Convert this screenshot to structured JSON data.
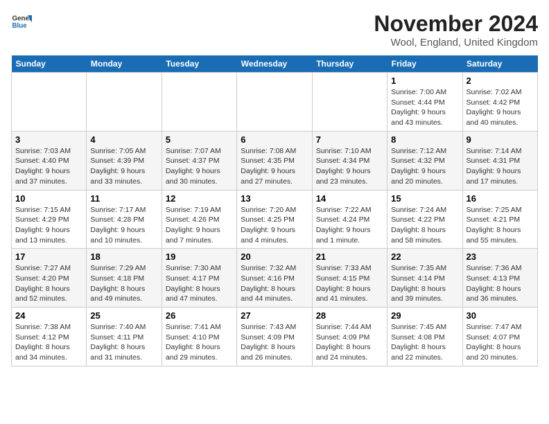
{
  "logo": {
    "line1": "General",
    "line2": "Blue"
  },
  "title": "November 2024",
  "subtitle": "Wool, England, United Kingdom",
  "days_of_week": [
    "Sunday",
    "Monday",
    "Tuesday",
    "Wednesday",
    "Thursday",
    "Friday",
    "Saturday"
  ],
  "weeks": [
    [
      {
        "day": "",
        "info": ""
      },
      {
        "day": "",
        "info": ""
      },
      {
        "day": "",
        "info": ""
      },
      {
        "day": "",
        "info": ""
      },
      {
        "day": "",
        "info": ""
      },
      {
        "day": "1",
        "info": "Sunrise: 7:00 AM\nSunset: 4:44 PM\nDaylight: 9 hours\nand 43 minutes."
      },
      {
        "day": "2",
        "info": "Sunrise: 7:02 AM\nSunset: 4:42 PM\nDaylight: 9 hours\nand 40 minutes."
      }
    ],
    [
      {
        "day": "3",
        "info": "Sunrise: 7:03 AM\nSunset: 4:40 PM\nDaylight: 9 hours\nand 37 minutes."
      },
      {
        "day": "4",
        "info": "Sunrise: 7:05 AM\nSunset: 4:39 PM\nDaylight: 9 hours\nand 33 minutes."
      },
      {
        "day": "5",
        "info": "Sunrise: 7:07 AM\nSunset: 4:37 PM\nDaylight: 9 hours\nand 30 minutes."
      },
      {
        "day": "6",
        "info": "Sunrise: 7:08 AM\nSunset: 4:35 PM\nDaylight: 9 hours\nand 27 minutes."
      },
      {
        "day": "7",
        "info": "Sunrise: 7:10 AM\nSunset: 4:34 PM\nDaylight: 9 hours\nand 23 minutes."
      },
      {
        "day": "8",
        "info": "Sunrise: 7:12 AM\nSunset: 4:32 PM\nDaylight: 9 hours\nand 20 minutes."
      },
      {
        "day": "9",
        "info": "Sunrise: 7:14 AM\nSunset: 4:31 PM\nDaylight: 9 hours\nand 17 minutes."
      }
    ],
    [
      {
        "day": "10",
        "info": "Sunrise: 7:15 AM\nSunset: 4:29 PM\nDaylight: 9 hours\nand 13 minutes."
      },
      {
        "day": "11",
        "info": "Sunrise: 7:17 AM\nSunset: 4:28 PM\nDaylight: 9 hours\nand 10 minutes."
      },
      {
        "day": "12",
        "info": "Sunrise: 7:19 AM\nSunset: 4:26 PM\nDaylight: 9 hours\nand 7 minutes."
      },
      {
        "day": "13",
        "info": "Sunrise: 7:20 AM\nSunset: 4:25 PM\nDaylight: 9 hours\nand 4 minutes."
      },
      {
        "day": "14",
        "info": "Sunrise: 7:22 AM\nSunset: 4:24 PM\nDaylight: 9 hours\nand 1 minute."
      },
      {
        "day": "15",
        "info": "Sunrise: 7:24 AM\nSunset: 4:22 PM\nDaylight: 8 hours\nand 58 minutes."
      },
      {
        "day": "16",
        "info": "Sunrise: 7:25 AM\nSunset: 4:21 PM\nDaylight: 8 hours\nand 55 minutes."
      }
    ],
    [
      {
        "day": "17",
        "info": "Sunrise: 7:27 AM\nSunset: 4:20 PM\nDaylight: 8 hours\nand 52 minutes."
      },
      {
        "day": "18",
        "info": "Sunrise: 7:29 AM\nSunset: 4:18 PM\nDaylight: 8 hours\nand 49 minutes."
      },
      {
        "day": "19",
        "info": "Sunrise: 7:30 AM\nSunset: 4:17 PM\nDaylight: 8 hours\nand 47 minutes."
      },
      {
        "day": "20",
        "info": "Sunrise: 7:32 AM\nSunset: 4:16 PM\nDaylight: 8 hours\nand 44 minutes."
      },
      {
        "day": "21",
        "info": "Sunrise: 7:33 AM\nSunset: 4:15 PM\nDaylight: 8 hours\nand 41 minutes."
      },
      {
        "day": "22",
        "info": "Sunrise: 7:35 AM\nSunset: 4:14 PM\nDaylight: 8 hours\nand 39 minutes."
      },
      {
        "day": "23",
        "info": "Sunrise: 7:36 AM\nSunset: 4:13 PM\nDaylight: 8 hours\nand 36 minutes."
      }
    ],
    [
      {
        "day": "24",
        "info": "Sunrise: 7:38 AM\nSunset: 4:12 PM\nDaylight: 8 hours\nand 34 minutes."
      },
      {
        "day": "25",
        "info": "Sunrise: 7:40 AM\nSunset: 4:11 PM\nDaylight: 8 hours\nand 31 minutes."
      },
      {
        "day": "26",
        "info": "Sunrise: 7:41 AM\nSunset: 4:10 PM\nDaylight: 8 hours\nand 29 minutes."
      },
      {
        "day": "27",
        "info": "Sunrise: 7:43 AM\nSunset: 4:09 PM\nDaylight: 8 hours\nand 26 minutes."
      },
      {
        "day": "28",
        "info": "Sunrise: 7:44 AM\nSunset: 4:09 PM\nDaylight: 8 hours\nand 24 minutes."
      },
      {
        "day": "29",
        "info": "Sunrise: 7:45 AM\nSunset: 4:08 PM\nDaylight: 8 hours\nand 22 minutes."
      },
      {
        "day": "30",
        "info": "Sunrise: 7:47 AM\nSunset: 4:07 PM\nDaylight: 8 hours\nand 20 minutes."
      }
    ]
  ]
}
